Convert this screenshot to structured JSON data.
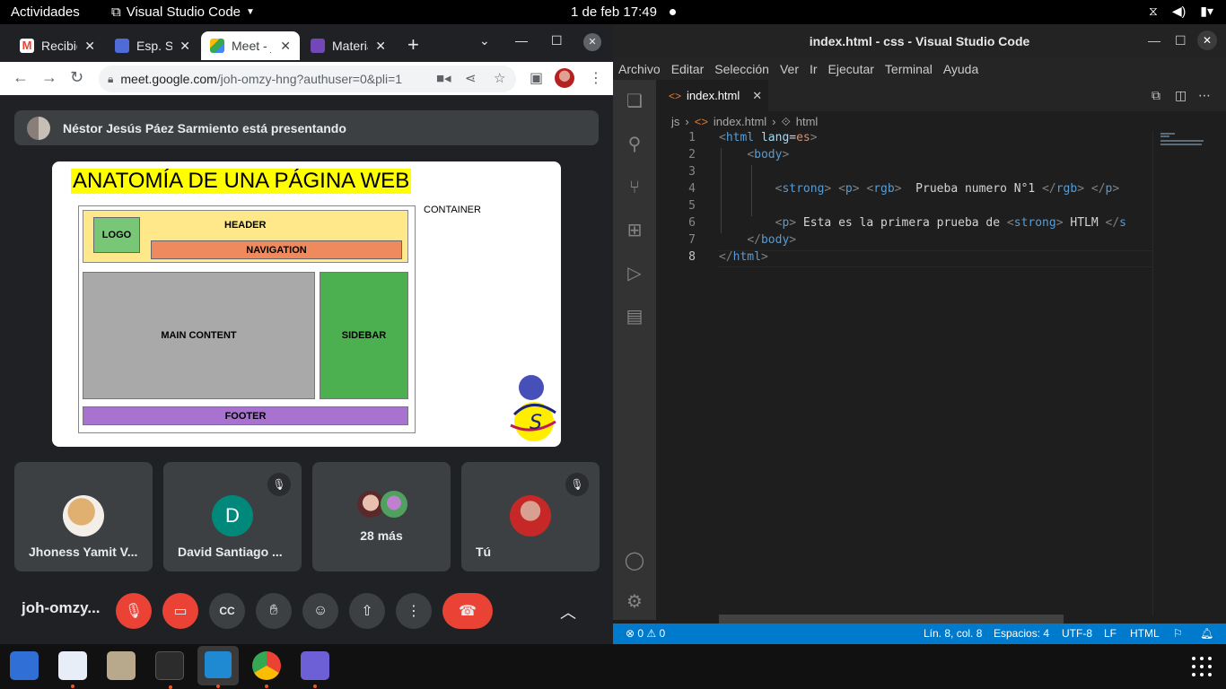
{
  "topbar": {
    "activities": "Actividades",
    "app_name": "Visual Studio Code",
    "clock": "1 de feb  17:49"
  },
  "chrome": {
    "tabs": [
      {
        "label": "Recibido",
        "icon": "gmail-icon",
        "color": "#ea4335"
      },
      {
        "label": "Esp. Sistema",
        "icon": "classroom-icon",
        "color": "#4e6bd8"
      },
      {
        "label": "Meet - joh-omzy",
        "icon": "meet-icon",
        "color": "#00897b"
      },
      {
        "label": "Materiales",
        "icon": "forms-icon",
        "color": "#7248b9"
      }
    ],
    "url_host": "meet.google.com",
    "url_path": "/joh-omzy-hng?authuser=0&pli=1"
  },
  "meet": {
    "presenting_text": "Néstor Jesús Páez Sarmiento está presentando",
    "slide": {
      "title": "ANATOMÍA DE UNA PÁGINA WEB",
      "container": "CONTAINER",
      "header": "HEADER",
      "logo": "LOGO",
      "navigation": "NAVIGATION",
      "main": "MAIN CONTENT",
      "sidebar": "SIDEBAR",
      "footer": "FOOTER"
    },
    "participants": [
      {
        "name": "Jhoness Yamit V...",
        "muted": false
      },
      {
        "name": "David Santiago ...",
        "initial": "D",
        "muted": true
      },
      {
        "name": "",
        "more": "28 más",
        "muted": false
      },
      {
        "name": "Tú",
        "muted": true
      }
    ],
    "meeting_code": "joh-omzy..."
  },
  "vscode": {
    "title": "index.html - css - Visual Studio Code",
    "menu": [
      "Archivo",
      "Editar",
      "Selección",
      "Ver",
      "Ir",
      "Ejecutar",
      "Terminal",
      "Ayuda"
    ],
    "tab": "index.html",
    "breadcrumbs": [
      "js",
      "index.html",
      "html"
    ],
    "line_numbers": [
      "1",
      "2",
      "3",
      "4",
      "5",
      "6",
      "7",
      "8"
    ],
    "status": {
      "problems": "⊗ 0 ⚠ 0",
      "position": "Lín. 8, col. 8",
      "spaces": "Espacios: 4",
      "encoding": "UTF-8",
      "eol": "LF",
      "language": "HTML"
    }
  }
}
